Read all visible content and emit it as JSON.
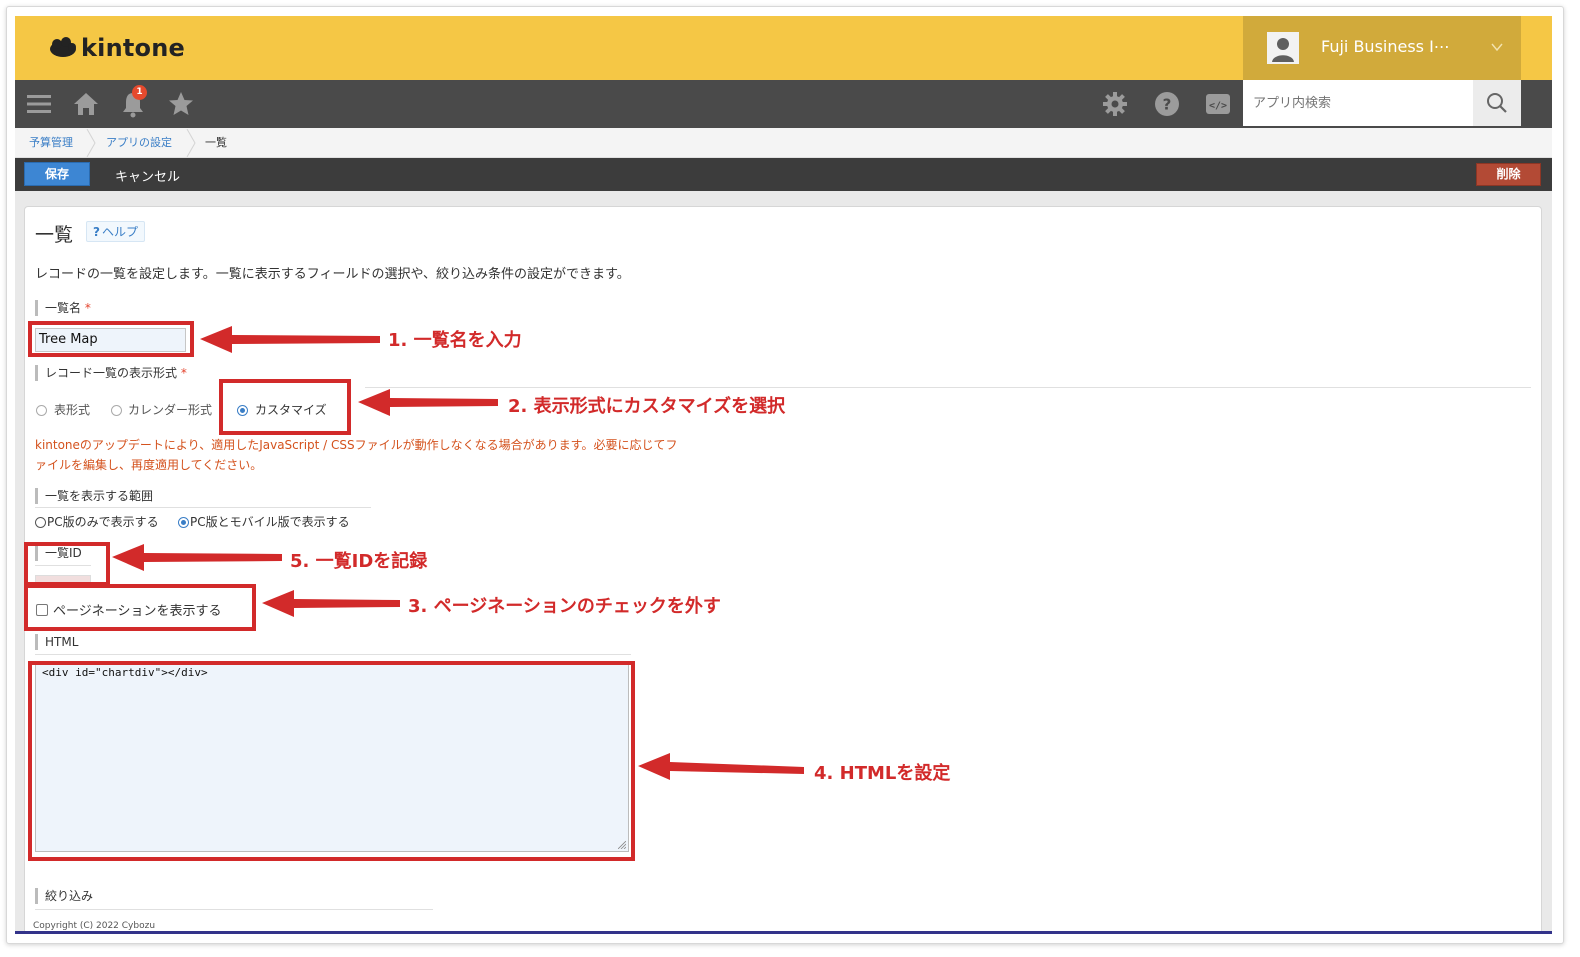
{
  "header": {
    "logo_text": "kintone",
    "user_name": "Fuji Business I⋯",
    "brand_color": "#f5c745"
  },
  "nav": {
    "notification_count": "1",
    "search_placeholder": "アプリ内検索",
    "icons": [
      "menu-icon",
      "home-icon",
      "bell-icon",
      "star-icon",
      "gear-icon",
      "help-icon",
      "code-icon",
      "search-icon"
    ]
  },
  "breadcrumb": {
    "items": [
      "予算管理",
      "アプリの設定",
      "一覧"
    ]
  },
  "actions": {
    "save_label": "保存",
    "cancel_label": "キャンセル",
    "delete_label": "削除"
  },
  "page": {
    "title": "一覧",
    "help_label": "ヘルプ",
    "description": "レコードの一覧を設定します。一覧に表示するフィールドの選択や、絞り込み条件の設定ができます。"
  },
  "form": {
    "view_name_label": "一覧名",
    "view_name_value": "Tree Map",
    "display_format_label": "レコード一覧の表示形式",
    "format_options": [
      "表形式",
      "カレンダー形式",
      "カスタマイズ"
    ],
    "selected_format": "カスタマイズ",
    "warning_line1": "kintoneのアップデートにより、適用したJavaScript / CSSファイルが動作しなくなる場合があります。必要に応じてフ",
    "warning_line2": "ァイルを編集し、再度適用してください。",
    "scope_label": "一覧を表示する範囲",
    "scope_options": [
      "PC版のみで表示する",
      "PC版とモバイル版で表示する"
    ],
    "selected_scope": "PC版とモバイル版で表示する",
    "view_id_label": "一覧ID",
    "pagination_label": "ページネーションを表示する",
    "pagination_checked": false,
    "html_label": "HTML",
    "html_value": "<div id=\"chartdiv\"></div>",
    "filter_label": "絞り込み"
  },
  "footer": {
    "copyright": "Copyright (C) 2022 Cybozu"
  },
  "annotations": {
    "step1": "1. 一覧名を入力",
    "step2": "2. 表示形式にカスタマイズを選択",
    "step3": "3. ページネーションのチェックを外す",
    "step4": "4. HTMLを設定",
    "step5": "5. 一覧IDを記録",
    "color": "#d22a2a"
  }
}
